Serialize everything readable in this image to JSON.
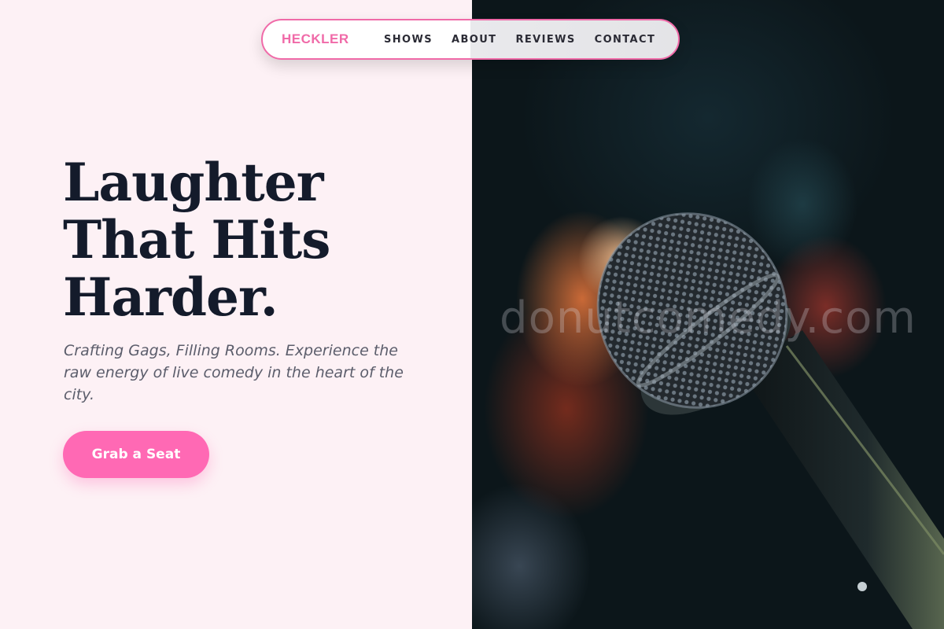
{
  "nav": {
    "brand": "HECKLER",
    "links": [
      "SHOWS",
      "ABOUT",
      "REVIEWS",
      "CONTACT"
    ]
  },
  "hero": {
    "title_lines": [
      "Laughter",
      "That Hits",
      "Harder."
    ],
    "subtitle": "Crafting Gags, Filling Rooms. Experience the raw energy of live comedy in the heart of the city.",
    "cta_label": "Grab a Seat"
  },
  "image": {
    "description_icon": "microphone-icon",
    "watermark": "donutcomedy.com"
  },
  "colors": {
    "accent": "#ff69b4",
    "heading": "#141b2b",
    "background": "#fdf1f5"
  }
}
